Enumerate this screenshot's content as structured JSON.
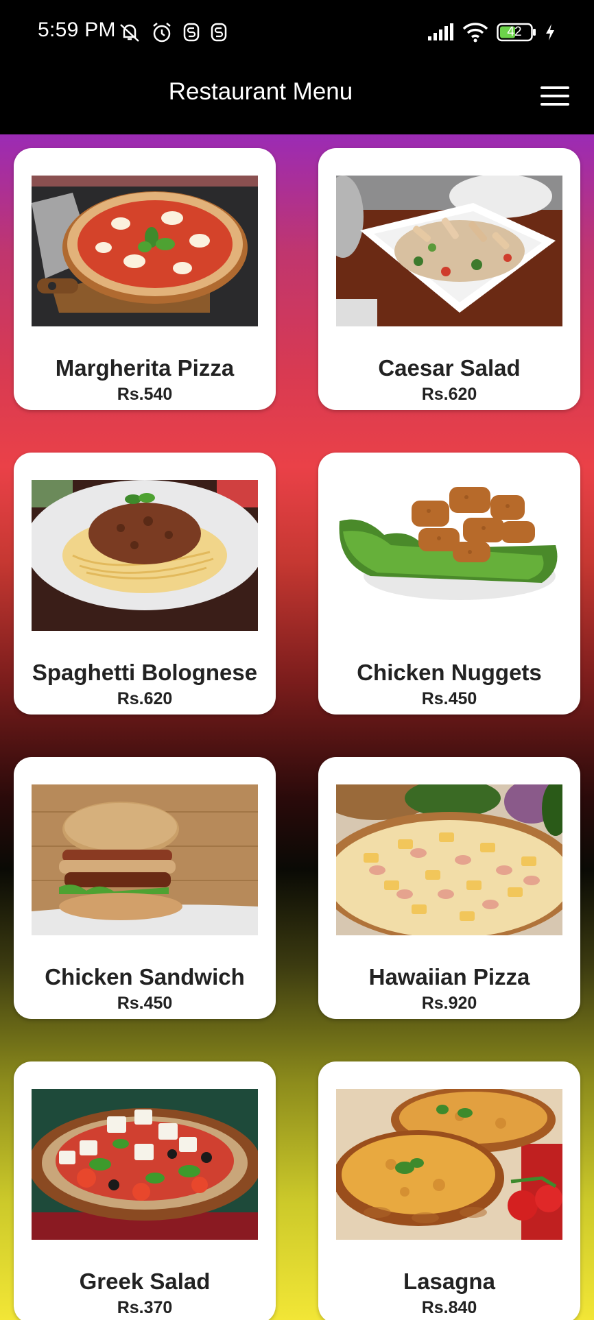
{
  "status_bar": {
    "time": "5:59 PM",
    "battery": "42",
    "icons": [
      "mute-icon",
      "alarm-icon",
      "s-app-icon",
      "s-app-icon",
      "signal-icon",
      "wifi-icon",
      "battery-icon",
      "charging-icon"
    ]
  },
  "app_bar": {
    "title": "Restaurant Menu",
    "menu_icon": "hamburger-menu-icon"
  },
  "menu": {
    "items": [
      {
        "name": "Margherita Pizza",
        "price": "Rs.540"
      },
      {
        "name": "Caesar Salad",
        "price": "Rs.620"
      },
      {
        "name": "Spaghetti Bolognese",
        "price": "Rs.620"
      },
      {
        "name": "Chicken Nuggets",
        "price": "Rs.450"
      },
      {
        "name": "Chicken Sandwich",
        "price": "Rs.450"
      },
      {
        "name": "Hawaiian Pizza",
        "price": "Rs.920"
      },
      {
        "name": "Greek Salad",
        "price": "Rs.370"
      },
      {
        "name": "Lasagna",
        "price": "Rs.840"
      }
    ]
  },
  "colors": {
    "app_bar": "#000000",
    "gradient_top": "#9b2bb5",
    "gradient_mid": "#ea4148",
    "gradient_dark": "#0a0a05",
    "gradient_bottom": "#f2e636",
    "card": "#ffffff",
    "text": "#222222"
  }
}
